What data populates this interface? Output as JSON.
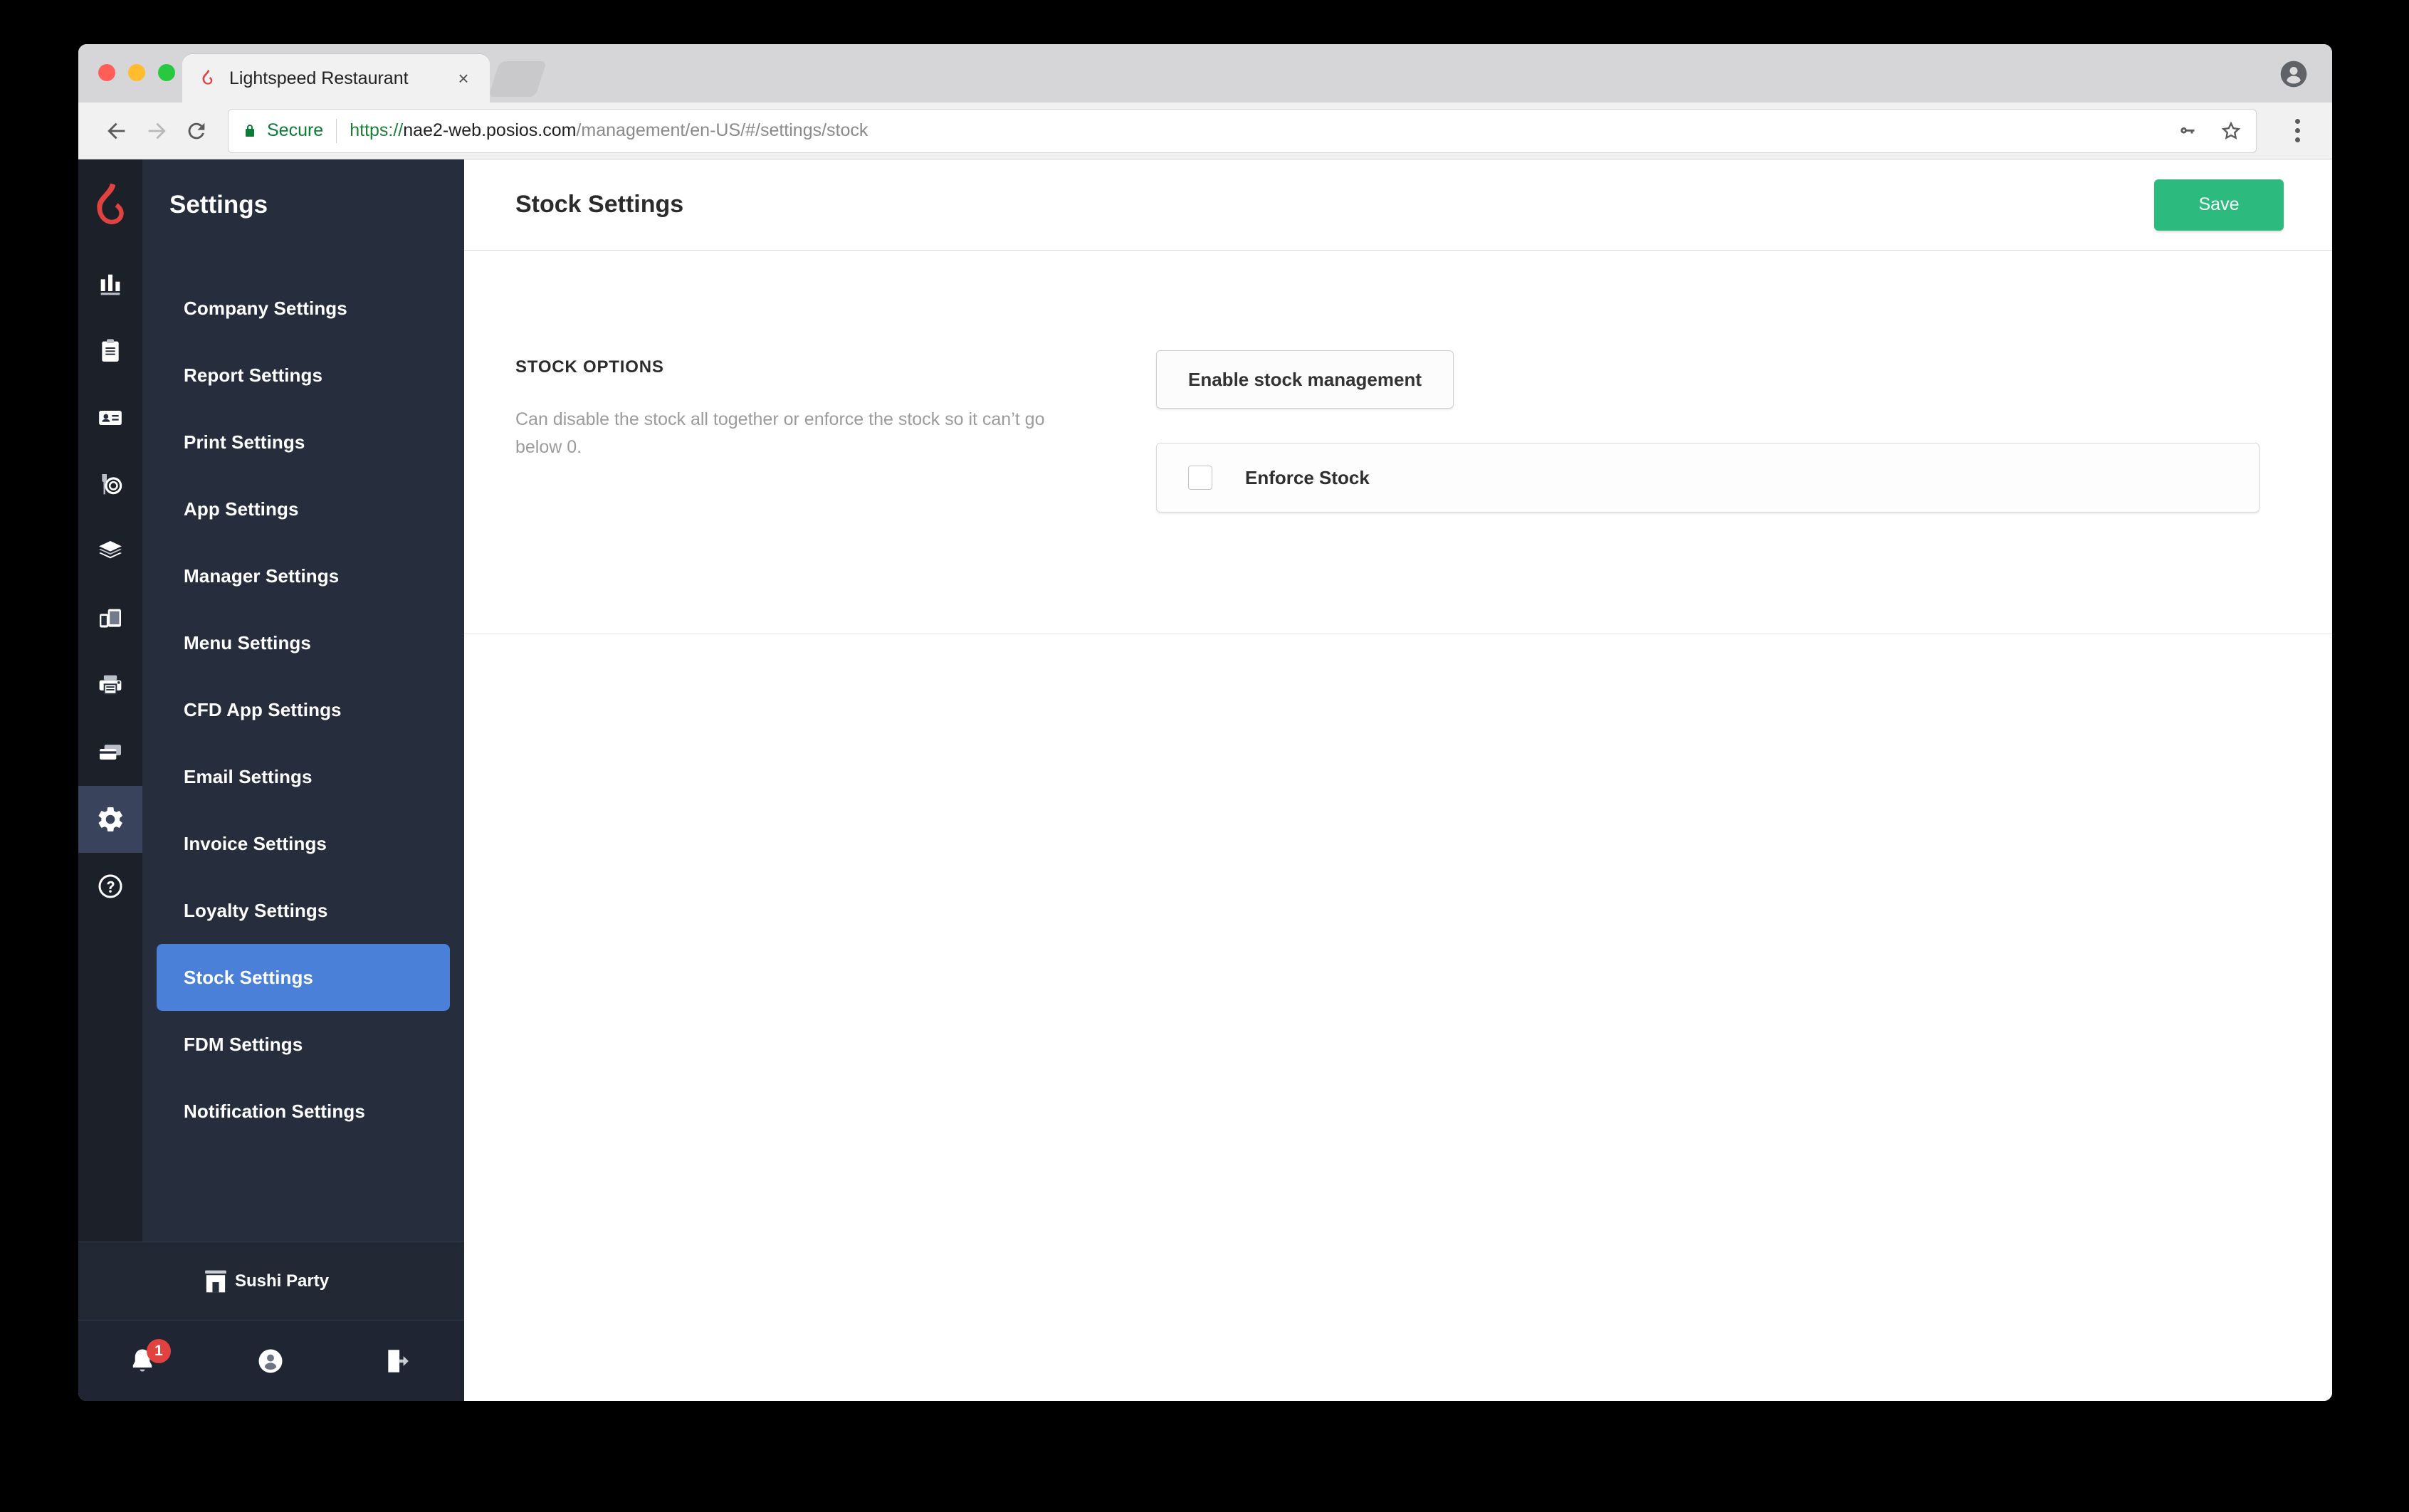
{
  "browser": {
    "tab": {
      "title": "Lightspeed Restaurant",
      "favicon": "lightspeed-flame-icon",
      "close": "×"
    },
    "new_tab_icon": "new-tab-icon",
    "profile_icon": "browser-profile-icon",
    "back_icon": "back-arrow-icon",
    "forward_icon": "forward-arrow-icon",
    "reload_icon": "reload-icon",
    "security": {
      "label": "Secure",
      "icon": "lock-icon"
    },
    "url": {
      "scheme": "https://",
      "host": "nae2-web.posios.com",
      "path": "/management/en-US/#/settings/stock",
      "full": "https://nae2-web.posios.com/management/en-US/#/settings/stock"
    },
    "omnibox_icons": [
      "key-icon",
      "bookmark-star-icon"
    ],
    "menu_icon": "three-dot-menu-icon"
  },
  "sidebar": {
    "logo": "lightspeed-flame-logo",
    "title": "Settings",
    "rail_icons": [
      {
        "name": "bar-chart-icon",
        "active": false
      },
      {
        "name": "clipboard-icon",
        "active": false
      },
      {
        "name": "id-card-icon",
        "active": false
      },
      {
        "name": "dining-icon",
        "active": false
      },
      {
        "name": "layers-icon",
        "active": false
      },
      {
        "name": "devices-icon",
        "active": false
      },
      {
        "name": "printer-icon",
        "active": false
      },
      {
        "name": "card-stack-icon",
        "active": false
      },
      {
        "name": "gear-icon",
        "active": true
      },
      {
        "name": "help-circle-icon",
        "active": false
      }
    ],
    "items": [
      {
        "label": "Company Settings",
        "active": false
      },
      {
        "label": "Report Settings",
        "active": false
      },
      {
        "label": "Print Settings",
        "active": false
      },
      {
        "label": "App Settings",
        "active": false
      },
      {
        "label": "Manager Settings",
        "active": false
      },
      {
        "label": "Menu Settings",
        "active": false
      },
      {
        "label": "CFD App Settings",
        "active": false
      },
      {
        "label": "Email Settings",
        "active": false
      },
      {
        "label": "Invoice Settings",
        "active": false
      },
      {
        "label": "Loyalty Settings",
        "active": false
      },
      {
        "label": "Stock Settings",
        "active": true
      },
      {
        "label": "FDM Settings",
        "active": false
      },
      {
        "label": "Notification Settings",
        "active": false
      }
    ],
    "store": {
      "name": "Sushi Party",
      "icon": "store-icon"
    },
    "actions": {
      "notifications": {
        "icon": "bell-icon",
        "badge": "1"
      },
      "account": {
        "icon": "user-circle-icon"
      },
      "logout": {
        "icon": "logout-icon"
      }
    }
  },
  "page": {
    "title": "Stock Settings",
    "save_label": "Save",
    "section": {
      "label": "STOCK OPTIONS",
      "description": "Can disable the stock all together or enforce the stock so it can’t go below 0.",
      "enable_button": "Enable stock management",
      "enforce": {
        "label": "Enforce Stock",
        "checked": false
      }
    }
  },
  "colors": {
    "accent_blue": "#4a80d8",
    "save_green": "#2cba7e",
    "brand_red": "#e0433f",
    "sidebar_dark": "#262d3d",
    "rail_dark": "#1c2029"
  }
}
